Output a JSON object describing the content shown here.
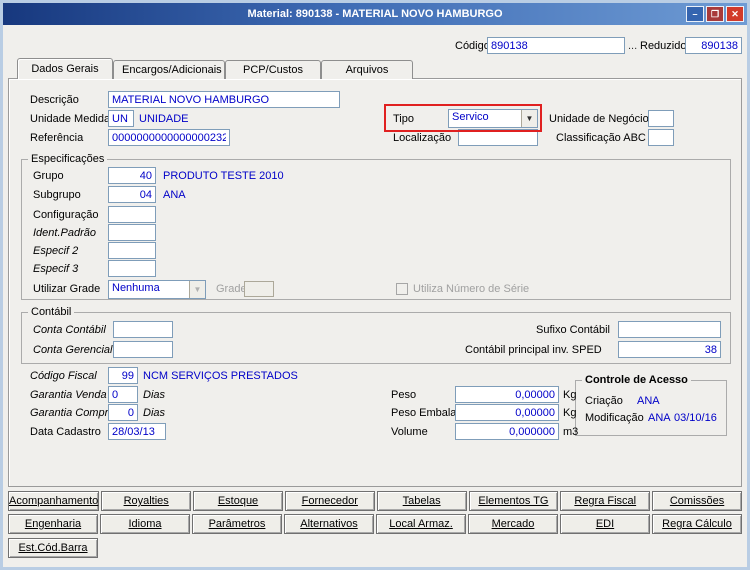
{
  "window": {
    "title": "Material: 890138 - MATERIAL NOVO HAMBURGO",
    "controls": {
      "minimize": "–",
      "maximize": "❐",
      "close": "✕"
    }
  },
  "header": {
    "codigo_label": "Código",
    "codigo_value": "890138",
    "browse_label": "...",
    "reduzido_label": "Reduzido",
    "reduzido_value": "890138"
  },
  "tabs": [
    {
      "label": "Dados Gerais"
    },
    {
      "label": "Encargos/Adicionais"
    },
    {
      "label": "PCP/Custos"
    },
    {
      "label": "Arquivos"
    }
  ],
  "general": {
    "descricao_label": "Descrição",
    "descricao_value": "MATERIAL NOVO HAMBURGO",
    "unidade_medida_label": "Unidade Medida",
    "unidade_medida_code": "UN",
    "unidade_medida_desc": "UNIDADE",
    "tipo_label": "Tipo",
    "tipo_value": "Servico",
    "unidade_negocio_label": "Unidade de Negócio",
    "referencia_label": "Referência",
    "referencia_value": "0000000000000000232",
    "localizacao_label": "Localização",
    "classificacao_abc_label": "Classificação ABC"
  },
  "especificacoes": {
    "legend": "Especificações",
    "grupo_label": "Grupo",
    "grupo_code": "40",
    "grupo_desc": "PRODUTO TESTE 2010",
    "subgrupo_label": "Subgrupo",
    "subgrupo_code": "04",
    "subgrupo_desc": "ANA",
    "configuracao_label": "Configuração",
    "ident_padrao_label": "Ident.Padrão",
    "especif2_label": "Especif 2",
    "especif3_label": "Especif 3",
    "utilizar_grade_label": "Utilizar Grade",
    "utilizar_grade_value": "Nenhuma",
    "grade_label": "Grade",
    "utiliza_numero_serie_label": "Utiliza Número de Série"
  },
  "contabil": {
    "legend": "Contábil",
    "conta_contabil_label": "Conta Contábil",
    "conta_gerencial_label": "Conta Gerencial",
    "sufixo_contabil_label": "Sufixo Contábil",
    "sped_label": "Contábil principal inv. SPED",
    "sped_value": "38"
  },
  "fiscal": {
    "codigo_fiscal_label": "Código Fiscal",
    "codigo_fiscal_code": "99",
    "codigo_fiscal_desc": "NCM SERVIÇOS PRESTADOS",
    "garantia_venda_label": "Garantia Venda",
    "garantia_venda_value": "0",
    "garantia_venda_unit": "Dias",
    "garantia_compra_label": "Garantia Compra",
    "garantia_compra_value": "0",
    "garantia_compra_unit": "Dias",
    "data_cadastro_label": "Data Cadastro",
    "data_cadastro_value": "28/03/13"
  },
  "medidas": {
    "peso_label": "Peso",
    "peso_value": "0,00000",
    "peso_unit": "Kg",
    "peso_embalagem_label": "Peso Embalagem",
    "peso_embalagem_value": "0,00000",
    "peso_embalagem_unit": "Kg",
    "volume_label": "Volume",
    "volume_value": "0,000000",
    "volume_unit": "m3"
  },
  "controle_acesso": {
    "legend": "Controle de Acesso",
    "criacao_label": "Criação",
    "criacao_value": "ANA",
    "modificacao_label": "Modificação",
    "modificacao_value": "ANA",
    "modificacao_date": "03/10/16"
  },
  "buttons": {
    "row1": [
      "Acompanhamento",
      "Royalties",
      "Estoque",
      "Fornecedor",
      "Tabelas",
      "Elementos TG",
      "Regra Fiscal",
      "Comissões"
    ],
    "row2": [
      "Engenharia",
      "Idioma",
      "Parâmetros",
      "Alternativos",
      "Local Armaz.",
      "Mercado",
      "EDI",
      "Regra Cálculo"
    ],
    "row3": [
      "Est.Cód.Barra"
    ]
  },
  "colors": {
    "value_text": "#0000C8",
    "highlight_border": "#E02020",
    "titlebar_blue": "#3E6BB4"
  }
}
